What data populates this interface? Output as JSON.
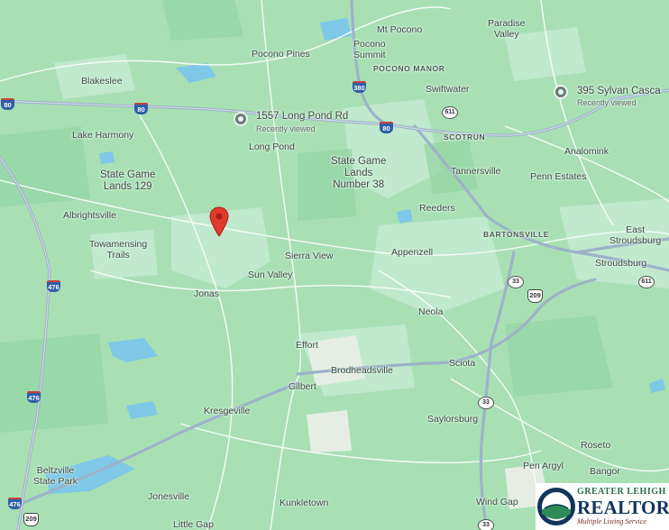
{
  "map": {
    "places": {
      "mt_pocono": "Mt Pocono",
      "paradise_valley": "Paradise\nValley",
      "pocono_pines": "Pocono Pines",
      "pocono_summit": "Pocono\nSummit",
      "pocono_manor": "POCONO MANOR",
      "blakeslee": "Blakeslee",
      "swiftwater": "Swiftwater",
      "lake_harmony": "Lake Harmony",
      "long_pond": "Long Pond",
      "scotrun": "SCOTRUN",
      "analomink": "Analomink",
      "sgl129": "State Game\nLands 129",
      "sgl38": "State Game\nLands\nNumber 38",
      "tannersville": "Tannersville",
      "penn_estates": "Penn Estates",
      "albrightsville": "Albrightsville",
      "reeders": "Reeders",
      "towamensing": "Towamensing\nTrails",
      "sierra_view": "Sierra View",
      "appenzell": "Appenzell",
      "bartonsville": "BARTONSVILLE",
      "east_stroudsburg": "East\nStroudsburg",
      "stroudsburg": "Stroudsburg",
      "sun_valley": "Sun Valley",
      "jonas": "Jonas",
      "neola": "Neola",
      "effort": "Effort",
      "brodheadsville": "Brodheadsville",
      "sciota": "Sciota",
      "gilbert": "Gilbert",
      "kresgeville": "Kresgeville",
      "saylorsburg": "Saylorsburg",
      "roseto": "Roseto",
      "beltzville": "Beltzville\nState Park",
      "pen_argyl": "Pen Argyl",
      "bangor": "Bangor",
      "jonesville": "Jonesville",
      "kunkletown": "Kunkletown",
      "wind_gap": "Wind Gap",
      "little_gap": "Little Gap"
    },
    "saved_places": [
      {
        "title": "1557 Long Pond Rd",
        "subtitle": "Recently viewed",
        "icon": "place-pin-icon"
      },
      {
        "title": "395 Sylvan Casca",
        "subtitle": "Recently viewed",
        "icon": "place-pin-icon"
      }
    ],
    "shields": {
      "i80_w": "80",
      "i80_a": "80",
      "i80_b": "380",
      "i80_c": "80",
      "pa611_a": "611",
      "pa611_b": "611",
      "us209_a": "209",
      "us209_b": "209",
      "pa33_a": "33",
      "pa33_b": "33",
      "pa33_c": "33",
      "i476_a": "476",
      "i476_b": "476",
      "i476_c": "476"
    },
    "marker": {
      "icon": "red-location-marker-icon",
      "color": "#e03a2f"
    },
    "colors": {
      "land": "#a8e0b4",
      "water": "#7fc8e8",
      "highway": "#9db2c9",
      "road": "#ffffff"
    }
  },
  "logo": {
    "line1": "GREATER LEHIGH VALLEY",
    "line2": "REALTORS",
    "line3": "Multiple Listing Service",
    "icon": "realtors-seal-icon"
  }
}
